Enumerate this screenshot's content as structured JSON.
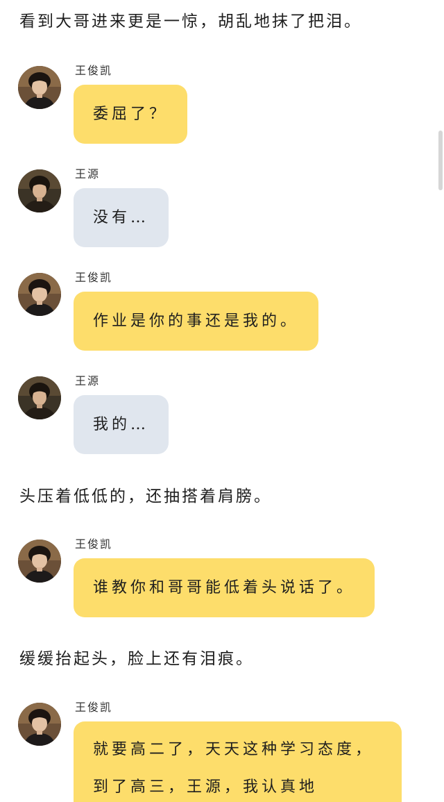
{
  "narration": {
    "line1": "看到大哥进来更是一惊，胡乱地抹了把泪。",
    "line2": "头压着低低的，还抽搭着肩膀。",
    "line3": "缓缓抬起头，脸上还有泪痕。"
  },
  "messages": [
    {
      "speaker": "王俊凯",
      "text": "委屈了？",
      "color": "#fddd6b"
    },
    {
      "speaker": "王源",
      "text": "没有…",
      "color": "#e0e6ee"
    },
    {
      "speaker": "王俊凯",
      "text": "作业是你的事还是我的。",
      "color": "#fddd6b"
    },
    {
      "speaker": "王源",
      "text": "我的…",
      "color": "#e0e6ee"
    },
    {
      "speaker": "王俊凯",
      "text": "谁教你和哥哥能低着头说话了。",
      "color": "#fddd6b"
    },
    {
      "speaker": "王俊凯",
      "text": "就要高二了，天天这种学习态度，到了高三，王源，我认真地",
      "color": "#fddd6b"
    }
  ],
  "icons": {
    "avatar": "avatar-photo"
  }
}
